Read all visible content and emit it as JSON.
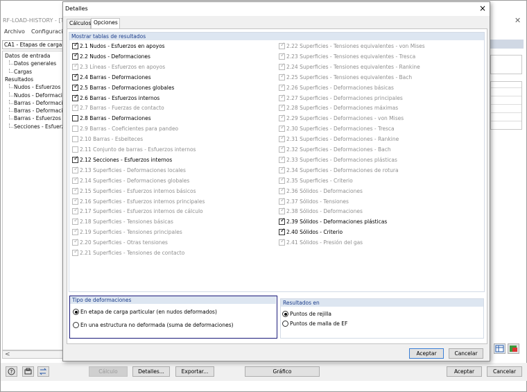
{
  "bgapp": {
    "title": "RF-LOAD-HISTORY - [TA",
    "menu": [
      "Archivo",
      "Configuració"
    ],
    "combo": "CA1 - Etapas de carga",
    "tree": [
      {
        "label": "Datos de entrada",
        "indent": 0
      },
      {
        "label": "Datos generales",
        "indent": 1
      },
      {
        "label": "Cargas",
        "indent": 1
      },
      {
        "label": "Resultados",
        "indent": 0
      },
      {
        "label": "Nudos - Esfuerzos en",
        "indent": 1
      },
      {
        "label": "Nudos - Deformacion",
        "indent": 1
      },
      {
        "label": "Barras - Deformacion",
        "indent": 1
      },
      {
        "label": "Barras - Deformacion",
        "indent": 1
      },
      {
        "label": "Barras - Esfuerzos in",
        "indent": 1
      },
      {
        "label": "Secciones - Esfuerzo",
        "indent": 1
      }
    ],
    "scroll_left": "<",
    "buttons": {
      "calculo": "Cálculo",
      "detalles": "Detalles...",
      "exportar": "Exportar...",
      "grafico": "Gráfico",
      "aceptar": "Aceptar",
      "cancelar": "Cancelar"
    }
  },
  "dialog": {
    "title": "Detalles",
    "close": "×",
    "tabs": [
      "Cálculos",
      "Opciones"
    ],
    "active_tab": "Opciones",
    "results_header": "Mostrar tablas de resultados",
    "left_items": [
      {
        "label": "2.1 Nudos - Esfuerzos en apoyos",
        "checked": true,
        "enabled": true
      },
      {
        "label": "2.2 Nudos - Deformaciones",
        "checked": true,
        "enabled": true
      },
      {
        "label": "2.3 Líneas - Esfuerzos en apoyos",
        "checked": true,
        "enabled": false
      },
      {
        "label": "2.4 Barras - Deformaciones",
        "checked": true,
        "enabled": true
      },
      {
        "label": "2.5 Barras - Deformaciones globales",
        "checked": true,
        "enabled": true
      },
      {
        "label": "2.6 Barras - Esfuerzos internos",
        "checked": true,
        "enabled": true
      },
      {
        "label": "2.7 Barras - Fuerzas de contacto",
        "checked": true,
        "enabled": false
      },
      {
        "label": "2.8 Barras - Deformaciones",
        "checked": false,
        "enabled": true
      },
      {
        "label": "2.9 Barras - Coeficientes para pandeo",
        "checked": false,
        "enabled": false
      },
      {
        "label": "2.10 Barras - Esbelteces",
        "checked": false,
        "enabled": false
      },
      {
        "label": "2.11 Conjunto de barras - Esfuerzos internos",
        "checked": false,
        "enabled": false
      },
      {
        "label": "2.12 Secciones - Esfuerzos internos",
        "checked": true,
        "enabled": true
      },
      {
        "label": "2.13 Superficies - Deformaciones locales",
        "checked": true,
        "enabled": false
      },
      {
        "label": "2.14 Superficies - Deformaciones globales",
        "checked": true,
        "enabled": false
      },
      {
        "label": "2.15 Superficies - Esfuerzos internos básicos",
        "checked": true,
        "enabled": false
      },
      {
        "label": "2.16 Superficies - Esfuerzos internos principales",
        "checked": true,
        "enabled": false
      },
      {
        "label": "2.17 Superficies - Esfuerzos internos de cálculo",
        "checked": true,
        "enabled": false
      },
      {
        "label": "2.18 Superficies - Tensiones básicas",
        "checked": true,
        "enabled": false
      },
      {
        "label": "2.19 Superficies - Tensiones principales",
        "checked": true,
        "enabled": false
      },
      {
        "label": "2.20 Superficies - Otras tensiones",
        "checked": true,
        "enabled": false
      },
      {
        "label": "2.21 Superficies - Tensiones de contacto",
        "checked": true,
        "enabled": false
      }
    ],
    "right_items": [
      {
        "label": "2.22 Superficies - Tensiones equivalentes - von Mises",
        "checked": true,
        "enabled": false
      },
      {
        "label": "2.23 Superficies - Tensiones equivalentes - Tresca",
        "checked": true,
        "enabled": false
      },
      {
        "label": "2.24 Superficies - Tensiones equivalentes - Rankine",
        "checked": true,
        "enabled": false
      },
      {
        "label": "2.25 Superficies - Tensiones equivalentes - Bach",
        "checked": true,
        "enabled": false
      },
      {
        "label": "2.26 Superficies - Deformaciones básicas",
        "checked": true,
        "enabled": false
      },
      {
        "label": "2.27 Superficies - Deformaciones principales",
        "checked": true,
        "enabled": false
      },
      {
        "label": "2.28 Superficies - Deformaciones máximas",
        "checked": true,
        "enabled": false
      },
      {
        "label": "2.29 Superficies - Deformaciones - von Mises",
        "checked": true,
        "enabled": false
      },
      {
        "label": "2.30 Superficies - Deformaciones - Tresca",
        "checked": true,
        "enabled": false
      },
      {
        "label": "2.31 Superficies - Deformaciones - Rankine",
        "checked": true,
        "enabled": false
      },
      {
        "label": "2.32 Superficies - Deformaciones - Bach",
        "checked": true,
        "enabled": false
      },
      {
        "label": "2.33 Superficies - Deformaciones plásticas",
        "checked": true,
        "enabled": false
      },
      {
        "label": "2.34 Superficies - Deformaciones de rotura",
        "checked": true,
        "enabled": false
      },
      {
        "label": "2.35 Superficies - Criterio",
        "checked": true,
        "enabled": false
      },
      {
        "label": "2.36 Sólidos - Deformaciones",
        "checked": true,
        "enabled": false
      },
      {
        "label": "2.37 Sólidos - Tensiones",
        "checked": true,
        "enabled": false
      },
      {
        "label": "2.38 Sólidos - Deformaciones",
        "checked": true,
        "enabled": false
      },
      {
        "label": "2.39 Sólidos - Deformaciones plásticas",
        "checked": true,
        "enabled": true
      },
      {
        "label": "2.40 Sólidos - Criterio",
        "checked": true,
        "enabled": true
      },
      {
        "label": "2.41 Sólidos - Presión del gas",
        "checked": true,
        "enabled": false
      }
    ],
    "def_type": {
      "header": "Tipo de deformaciones",
      "options": [
        {
          "label": "En etapa de carga particular (en nudos deformados)",
          "selected": true
        },
        {
          "label": "En una estructura no deformada (suma de deformaciones)",
          "selected": false
        }
      ]
    },
    "results_in": {
      "header": "Resultados en",
      "options": [
        {
          "label": "Puntos de rejilla",
          "selected": true
        },
        {
          "label": "Puntos de malla de EF",
          "selected": false
        }
      ]
    },
    "ok": "Aceptar",
    "cancel": "Cancelar"
  }
}
